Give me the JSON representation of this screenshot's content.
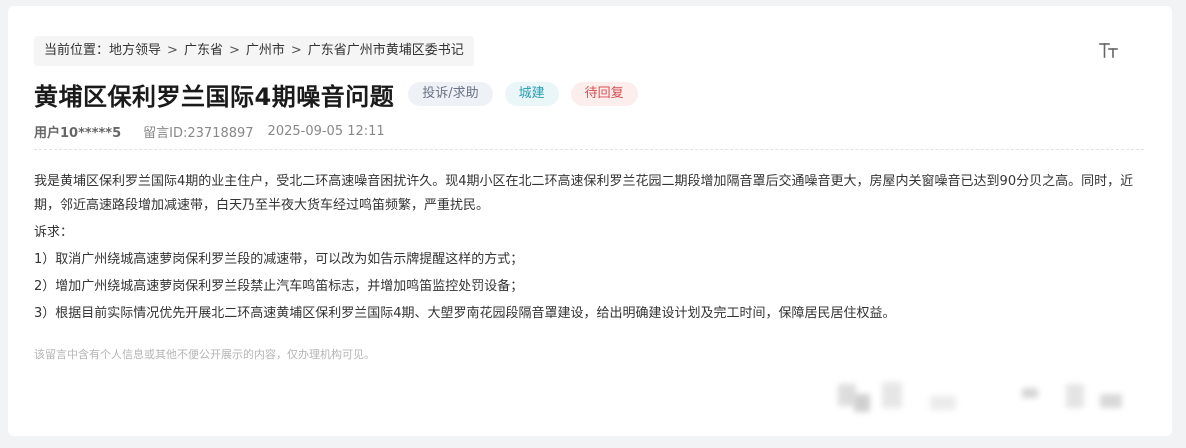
{
  "breadcrumb": {
    "prefix": "当前位置：",
    "items": [
      "地方领导",
      "广东省",
      "广州市",
      "广东省广州市黄埔区委书记"
    ],
    "separator": ">"
  },
  "font_size_toggle": {
    "icon": "font-size-icon",
    "glyph": "TT"
  },
  "post": {
    "title": "黄埔区保利罗兰国际4期噪音问题",
    "tags": {
      "type": "投诉/求助",
      "domain": "城建",
      "status": "待回复"
    },
    "user": "用户10*****5",
    "message_id": "留言ID:23718897",
    "datetime": "2025-09-05 12:11",
    "content": {
      "paragraph1": "我是黄埔区保利罗兰国际4期的业主住户，受北二环高速噪音困扰许久。现4期小区在北二环高速保利罗兰花园二期段增加隔音罩后交通噪音更大，房屋内关窗噪音已达到90分贝之高。同时，近期，邻近高速路段增加减速带，白天乃至半夜大货车经过鸣笛频繁，严重扰民。",
      "demands_label": "诉求：",
      "demand1": "1）取消广州绕城高速萝岗保利罗兰段的减速带，可以改为如告示牌提醒这样的方式；",
      "demand2": "2）增加广州绕城高速萝岗保利罗兰段禁止汽车鸣笛标志，并增加鸣笛监控处罚设备；",
      "demand3": "3）根据目前实际情况优先开展北二环高速黄埔区保利罗兰国际4期、大塱罗南花园段隔音罩建设，给出明确建设计划及完工时间，保障居民居住权益。"
    },
    "notice": "该留言中含有个人信息或其他不便公开展示的内容，仅办理机构可见。"
  },
  "colors": {
    "tag_type_bg": "#eef1f6",
    "tag_type_text": "#6a7385",
    "tag_domain_bg": "#eaf6f8",
    "tag_domain_text": "#2a9cb4",
    "tag_status_bg": "#fdeeee",
    "tag_status_text": "#d74d4d"
  }
}
